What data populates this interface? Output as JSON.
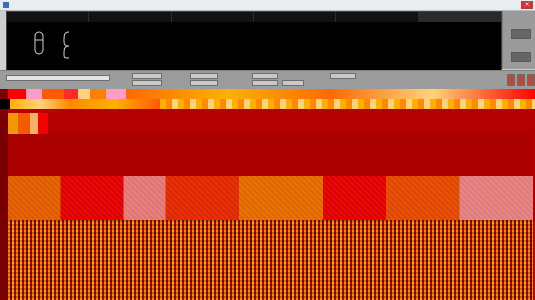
{
  "window": {
    "title": "",
    "close_label": "×"
  },
  "preview": {
    "tabs": [
      "",
      "",
      "",
      "",
      "",
      ""
    ],
    "active_tab_index": 5
  },
  "right_panel": {
    "labels": [
      "",
      ""
    ],
    "values": [
      "",
      ""
    ]
  },
  "controls": {
    "name_value": "",
    "labels": [
      "",
      "",
      "",
      "",
      "",
      "",
      "",
      ""
    ],
    "values": [
      "",
      "",
      "",
      "",
      "",
      "",
      "",
      ""
    ],
    "colors": {
      "panel": "#9c9c9c",
      "input": "#e5e5e5"
    }
  },
  "icons": {
    "app": "app-icon",
    "close": "close-icon",
    "glyph_left": "capsule-icon",
    "glyph_right": "bracket-icon",
    "toolbar": [
      "palette-icon",
      "palette-icon",
      "palette-icon"
    ]
  },
  "colors": {
    "accent_red": "#b30000",
    "accent_orange": "#ff8a00",
    "accent_yellow": "#ffb100",
    "pink": "#ff9cc8",
    "dark": "#000000"
  }
}
